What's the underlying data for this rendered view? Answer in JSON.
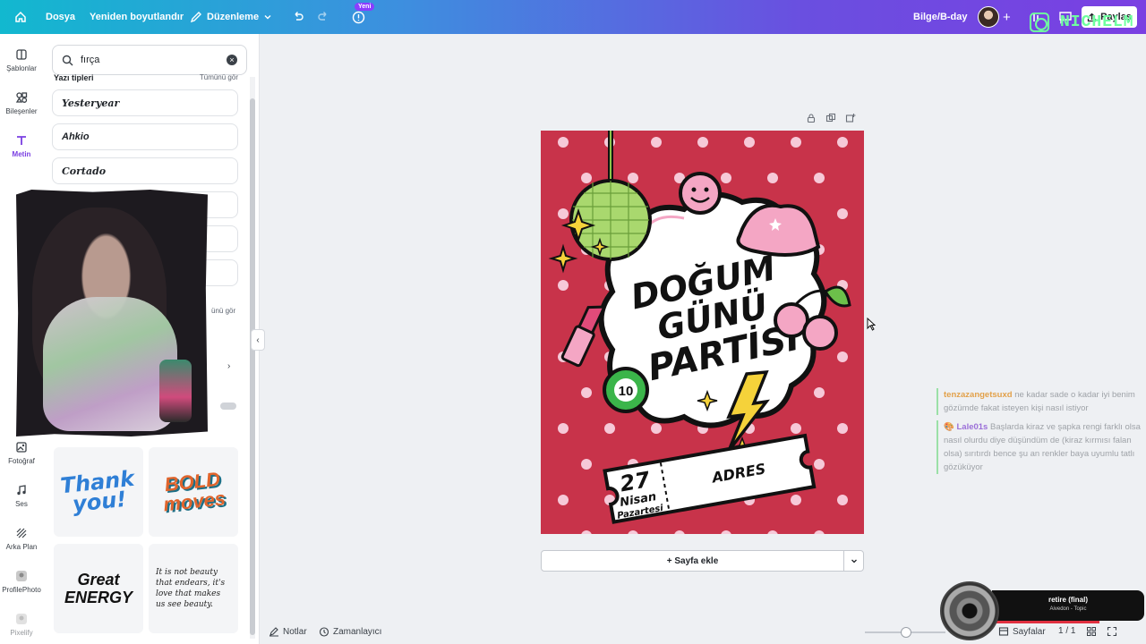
{
  "topbar": {
    "menu": [
      "Dosya",
      "Yeniden boyutlandır",
      "Düzenleme"
    ],
    "new_badge": "Yeni",
    "doc_title": "Bilge/B-day",
    "share_label": "Paylaş",
    "watermark_text": "NICHELM",
    "gradient_colors": [
      "#12b8cf",
      "#7a3fe2"
    ]
  },
  "rail": [
    {
      "label": "Şablonlar",
      "icon": "template-icon"
    },
    {
      "label": "Bileşenler",
      "icon": "elements-icon"
    },
    {
      "label": "Metin",
      "icon": "text-icon",
      "active": true
    },
    {
      "label": "Fotoğraf",
      "icon": "photo-icon"
    },
    {
      "label": "Ses",
      "icon": "audio-icon"
    },
    {
      "label": "Arka Plan",
      "icon": "background-icon"
    },
    {
      "label": "ProfilePhoto",
      "icon": "profilephoto-icon"
    },
    {
      "label": "Pixelify",
      "icon": "pixelify-icon"
    }
  ],
  "panel": {
    "search_value": "fırça",
    "section_title": "Yazı tipleri",
    "see_all": "Tümünü gör",
    "see_all_2": "ünü gör",
    "fonts": [
      "Yesteryear",
      "Ahkio",
      "Cortado"
    ],
    "stickers": [
      "Thank you!",
      "BOLD moves",
      "Great ENERGY",
      "It is not beauty that endears, it's love that makes us see beauty."
    ]
  },
  "design": {
    "title_lines": [
      "DOĞUM",
      "GÜNÜ",
      "PARTİSİ"
    ],
    "ball_number": "10",
    "date_day": "27",
    "date_month": "Nisan",
    "date_weekday": "Pazartesi",
    "address": "ADRES",
    "background_color": "#c8334a"
  },
  "canvas": {
    "add_page_label": "+ Sayfa ekle"
  },
  "bottombar": {
    "notes": "Notlar",
    "timer": "Zamanlayıcı",
    "pages": "Sayfalar",
    "page_count": "1 / 1"
  },
  "chat": [
    {
      "user": "tenzazangetsuxd",
      "text": "ne kadar sade o kadar iyi benim gözümde fakat isteyen kişi nasıl istiyor"
    },
    {
      "user": "Lale01s",
      "text": "Başlarda kiraz ve şapka rengi farklı olsa nasıl olurdu diye düşündüm de (kiraz kırmısı falan olsa) sırıtırdı bence şu an renkler baya uyumlu tatlı gözüküyor"
    }
  ],
  "music": {
    "title": "retire (final)",
    "artist": "Aivedon - Topic"
  }
}
